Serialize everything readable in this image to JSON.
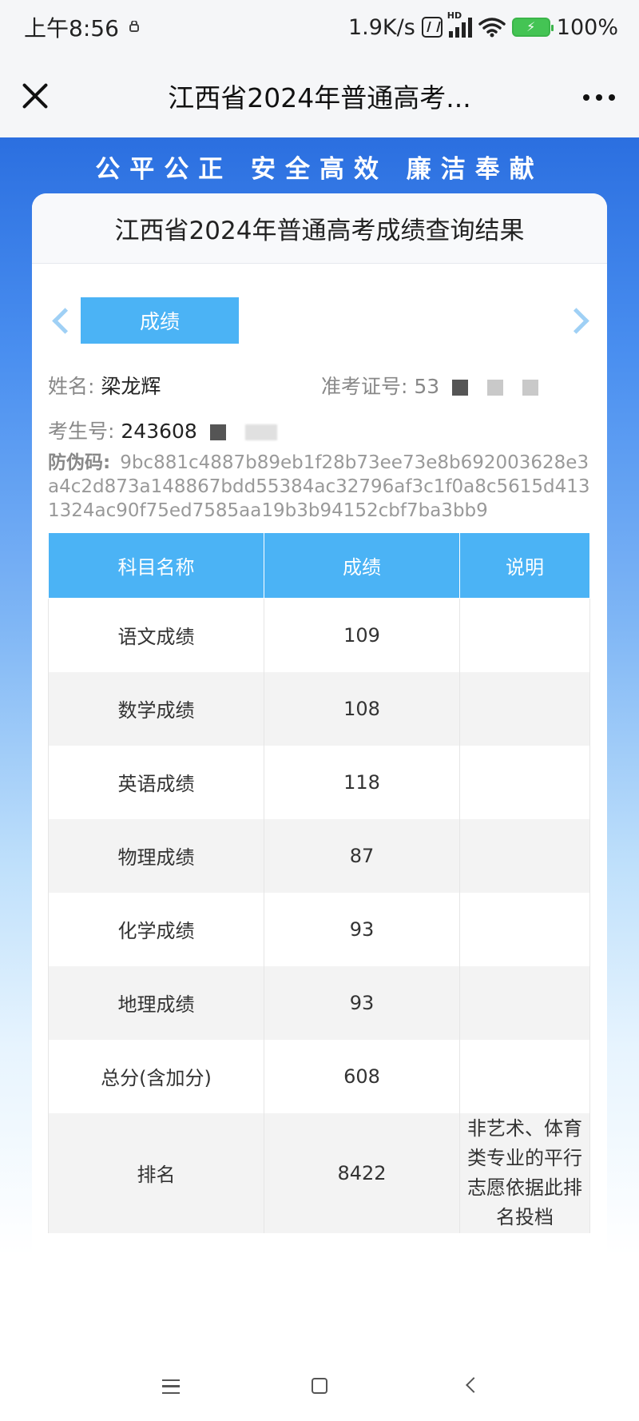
{
  "status_bar": {
    "time": "上午8:56",
    "network_speed": "1.9K/s",
    "signal_badge": "HD",
    "battery": "100%"
  },
  "app_bar": {
    "title": "江西省2024年普通高考..."
  },
  "banner": {
    "slogan": "公平公正 安全高效 廉洁奉献"
  },
  "card": {
    "title": "江西省2024年普通高考成绩查询结果",
    "active_tab": "成绩",
    "name_label": "姓名:",
    "name_value": "梁龙辉",
    "admission_label": "准考证号:",
    "admission_value": "53",
    "candidate_label": "考生号:",
    "candidate_value": "243608",
    "antifake_label": "防伪码:",
    "antifake_value": "9bc881c4887b89eb1f28b73ee73e8b692003628e3a4c2d873a148867bdd55384ac32796af3c1f0a8c5615d4131324ac90f75ed7585aa19b3b94152cbf7ba3bb9"
  },
  "table": {
    "headers": [
      "科目名称",
      "成绩",
      "说明"
    ],
    "rows": [
      {
        "subject": "语文成绩",
        "score": "109",
        "note": ""
      },
      {
        "subject": "数学成绩",
        "score": "108",
        "note": ""
      },
      {
        "subject": "英语成绩",
        "score": "118",
        "note": ""
      },
      {
        "subject": "物理成绩",
        "score": "87",
        "note": ""
      },
      {
        "subject": "化学成绩",
        "score": "93",
        "note": ""
      },
      {
        "subject": "地理成绩",
        "score": "93",
        "note": ""
      },
      {
        "subject": "总分(含加分)",
        "score": "608",
        "note": ""
      },
      {
        "subject": "排名",
        "score": "8422",
        "note": "非艺术、体育类专业的平行志愿依据此排名投档"
      }
    ]
  },
  "colors": {
    "accent_blue": "#4bb3f5",
    "banner_blue": "#2b6fe0",
    "battery_green": "#44c454"
  },
  "icons": [
    "close-icon",
    "more-icon",
    "chevron-left-icon",
    "chevron-right-icon",
    "menu-icon",
    "home-icon",
    "back-icon",
    "wifi-icon",
    "signal-icon",
    "nfc-icon",
    "battery-icon"
  ]
}
